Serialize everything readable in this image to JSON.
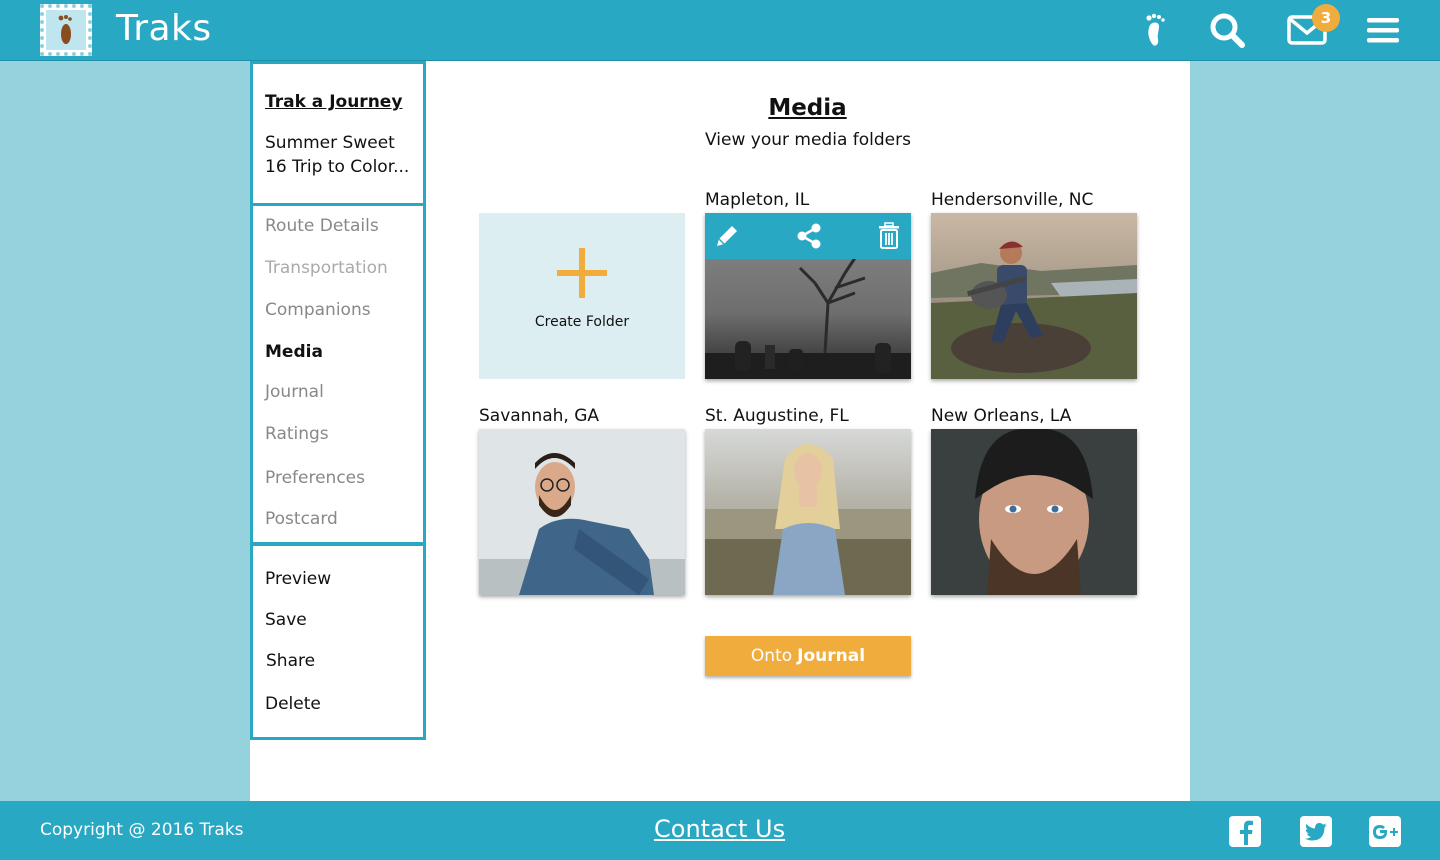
{
  "header": {
    "brand": "Traks",
    "notification_count": "3",
    "icons": [
      "footprint-icon",
      "search-icon",
      "mail-icon",
      "menu-icon"
    ]
  },
  "sidebar": {
    "section_title": "Trak a Journey",
    "trip_name": "Summer Sweet 16 Trip to Color...",
    "nav": [
      "Route Details",
      "Transportation",
      "Companions",
      "Media",
      "Journal",
      "Ratings",
      "Preferences",
      "Postcard"
    ],
    "active": "Media",
    "actions": [
      "Preview",
      "Save",
      "Share",
      "Delete"
    ]
  },
  "main": {
    "title": "Media",
    "subtitle": "View your media folders",
    "create_label": "Create Folder",
    "folders": [
      {
        "label": "Mapleton, IL"
      },
      {
        "label": "Hendersonville, NC"
      },
      {
        "label": "Savannah, GA"
      },
      {
        "label": "St. Augustine, FL"
      },
      {
        "label": "New Orleans, LA"
      }
    ],
    "overlay_icons": [
      "edit-icon",
      "share-icon",
      "trash-icon"
    ],
    "cta_prefix": "Onto",
    "cta_bold": "Journal"
  },
  "footer": {
    "copyright": "Copyright @ 2016 Traks",
    "contact": "Contact Us",
    "social": [
      "facebook-icon",
      "twitter-icon",
      "google-plus-icon"
    ]
  },
  "colors": {
    "primary": "#29a8c3",
    "background": "#94d3dd",
    "accent": "#f0ad3d",
    "create_bg": "#ddeef3"
  }
}
